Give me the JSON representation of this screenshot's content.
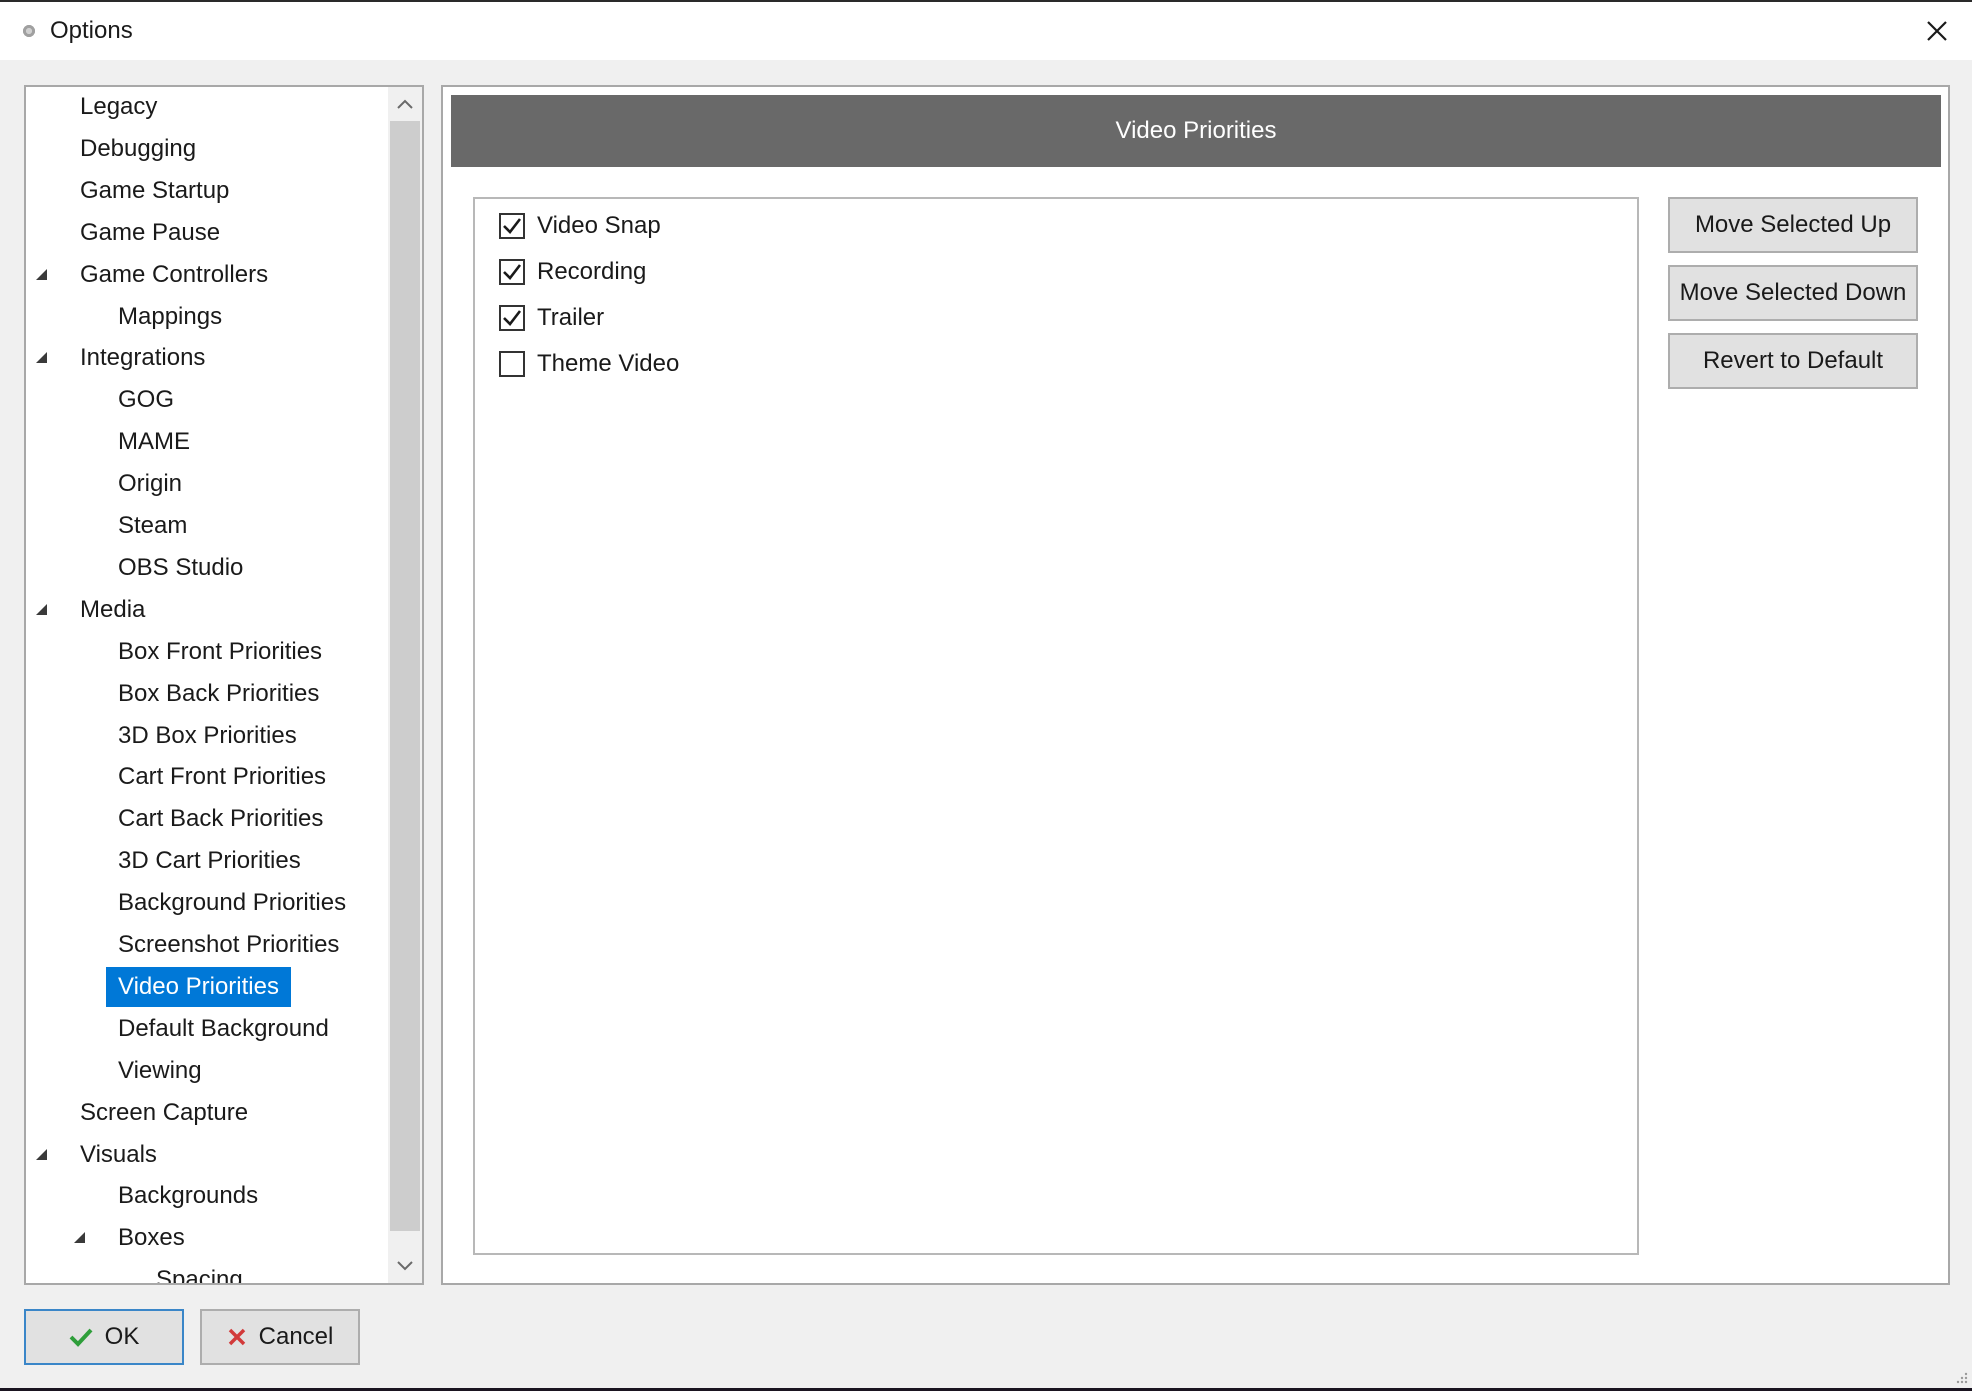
{
  "window": {
    "title": "Options",
    "close_icon": "close-icon"
  },
  "tree": {
    "items": [
      {
        "label": "Legacy",
        "level": 0,
        "expanded": null,
        "selected": false
      },
      {
        "label": "Debugging",
        "level": 0,
        "expanded": null,
        "selected": false
      },
      {
        "label": "Game Startup",
        "level": 0,
        "expanded": null,
        "selected": false
      },
      {
        "label": "Game Pause",
        "level": 0,
        "expanded": null,
        "selected": false
      },
      {
        "label": "Game Controllers",
        "level": 0,
        "expanded": true,
        "selected": false
      },
      {
        "label": "Mappings",
        "level": 1,
        "expanded": null,
        "selected": false
      },
      {
        "label": "Integrations",
        "level": 0,
        "expanded": true,
        "selected": false
      },
      {
        "label": "GOG",
        "level": 1,
        "expanded": null,
        "selected": false
      },
      {
        "label": "MAME",
        "level": 1,
        "expanded": null,
        "selected": false
      },
      {
        "label": "Origin",
        "level": 1,
        "expanded": null,
        "selected": false
      },
      {
        "label": "Steam",
        "level": 1,
        "expanded": null,
        "selected": false
      },
      {
        "label": "OBS Studio",
        "level": 1,
        "expanded": null,
        "selected": false
      },
      {
        "label": "Media",
        "level": 0,
        "expanded": true,
        "selected": false
      },
      {
        "label": "Box Front Priorities",
        "level": 1,
        "expanded": null,
        "selected": false
      },
      {
        "label": "Box Back Priorities",
        "level": 1,
        "expanded": null,
        "selected": false
      },
      {
        "label": "3D Box Priorities",
        "level": 1,
        "expanded": null,
        "selected": false
      },
      {
        "label": "Cart Front Priorities",
        "level": 1,
        "expanded": null,
        "selected": false
      },
      {
        "label": "Cart Back Priorities",
        "level": 1,
        "expanded": null,
        "selected": false
      },
      {
        "label": "3D Cart Priorities",
        "level": 1,
        "expanded": null,
        "selected": false
      },
      {
        "label": "Background Priorities",
        "level": 1,
        "expanded": null,
        "selected": false
      },
      {
        "label": "Screenshot Priorities",
        "level": 1,
        "expanded": null,
        "selected": false
      },
      {
        "label": "Video Priorities",
        "level": 1,
        "expanded": null,
        "selected": true
      },
      {
        "label": "Default Background",
        "level": 1,
        "expanded": null,
        "selected": false
      },
      {
        "label": "Viewing",
        "level": 1,
        "expanded": null,
        "selected": false
      },
      {
        "label": "Screen Capture",
        "level": 0,
        "expanded": null,
        "selected": false
      },
      {
        "label": "Visuals",
        "level": 0,
        "expanded": true,
        "selected": false
      },
      {
        "label": "Backgrounds",
        "level": 1,
        "expanded": null,
        "selected": false
      },
      {
        "label": "Boxes",
        "level": 1,
        "expanded": true,
        "selected": false
      },
      {
        "label": "Spacing",
        "level": 2,
        "expanded": null,
        "selected": false
      }
    ],
    "scroll_up_icon": "chevron-up-icon",
    "scroll_down_icon": "chevron-down-icon"
  },
  "content": {
    "header": "Video Priorities",
    "options": [
      {
        "label": "Video Snap",
        "checked": true
      },
      {
        "label": "Recording",
        "checked": true
      },
      {
        "label": "Trailer",
        "checked": true
      },
      {
        "label": "Theme Video",
        "checked": false
      }
    ],
    "buttons": {
      "move_up": "Move Selected Up",
      "move_down": "Move Selected Down",
      "revert": "Revert to Default"
    }
  },
  "footer": {
    "ok_label": "OK",
    "ok_icon": "checkmark-icon",
    "cancel_label": "Cancel",
    "cancel_icon": "x-icon"
  },
  "colors": {
    "selection": "#0078d7",
    "header_bg": "#696969",
    "ok_check": "#2e9e3a",
    "cancel_x": "#d23a3a"
  }
}
